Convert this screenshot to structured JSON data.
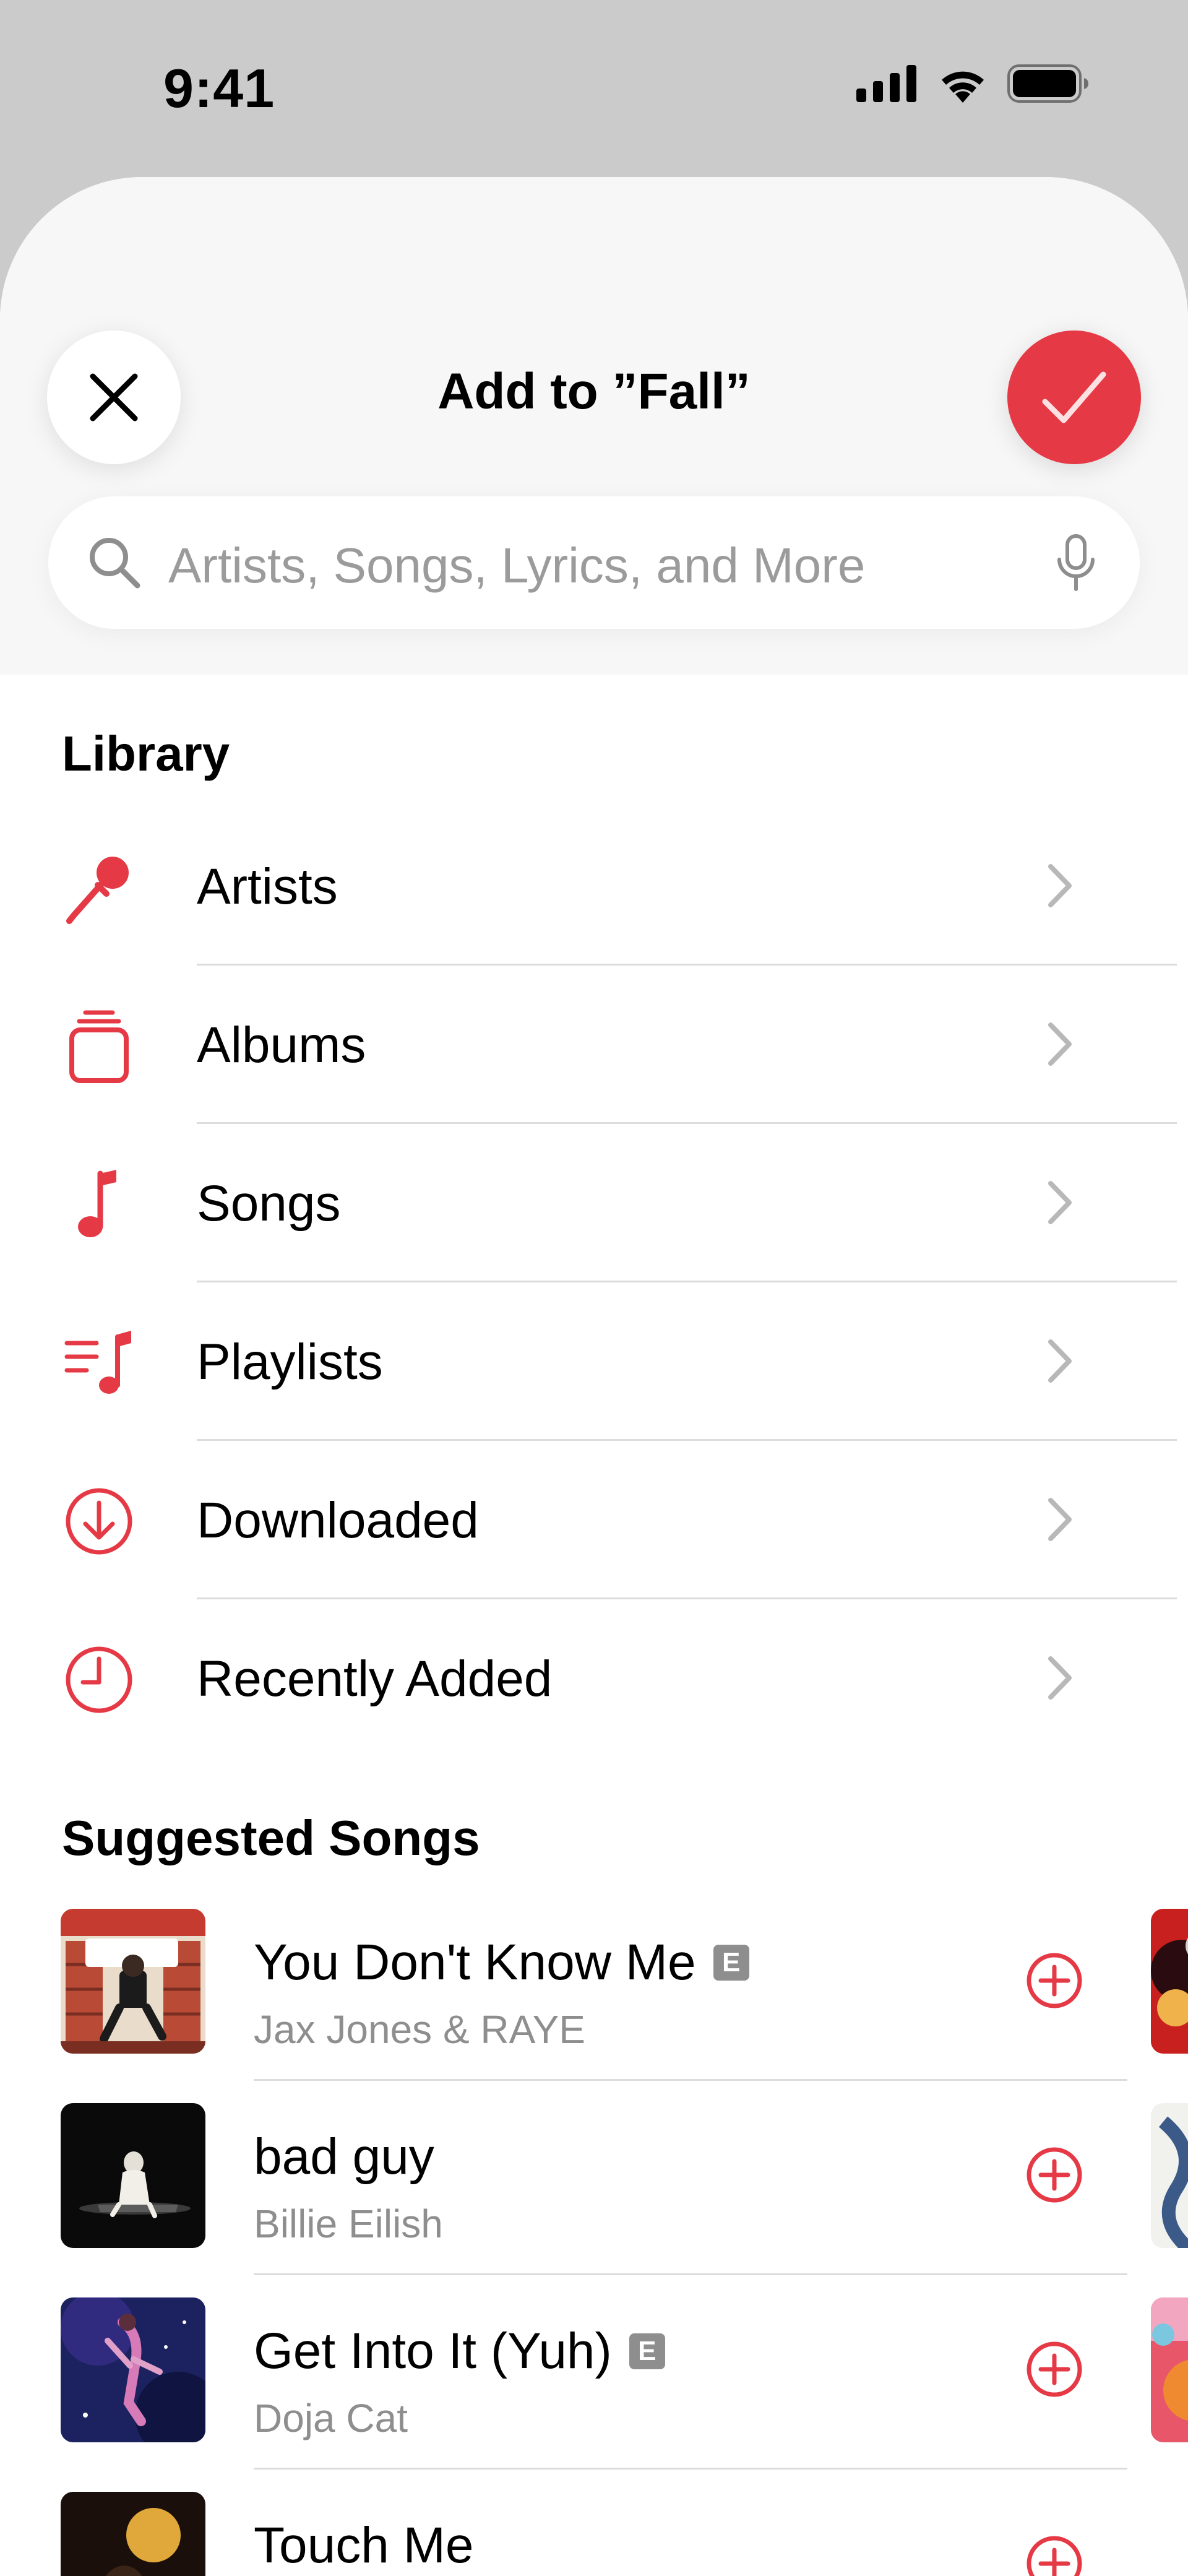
{
  "status_bar": {
    "time": "9:41"
  },
  "header": {
    "title": "Add to ”Fall”",
    "search_placeholder": "Artists, Songs, Lyrics, and More"
  },
  "library": {
    "title": "Library",
    "items": [
      {
        "label": "Artists",
        "icon": "microphone-icon"
      },
      {
        "label": "Albums",
        "icon": "album-stack-icon"
      },
      {
        "label": "Songs",
        "icon": "music-note-icon"
      },
      {
        "label": "Playlists",
        "icon": "playlist-icon"
      },
      {
        "label": "Downloaded",
        "icon": "download-circle-icon"
      },
      {
        "label": "Recently Added",
        "icon": "clock-icon"
      }
    ]
  },
  "suggested": {
    "title": "Suggested Songs",
    "songs": [
      {
        "title": "You Don't Know Me",
        "artist": "Jax Jones & RAYE",
        "explicit": true,
        "explicit_label": "E"
      },
      {
        "title": "bad guy",
        "artist": "Billie Eilish",
        "explicit": false
      },
      {
        "title": "Get Into It (Yuh)",
        "artist": "Doja Cat",
        "explicit": true,
        "explicit_label": "E"
      },
      {
        "title": "Touch Me",
        "artist": "",
        "explicit": false
      }
    ]
  },
  "colors": {
    "accent": "#e63946",
    "secondary_text": "#8e8e8e",
    "sheet_header_bg": "#f7f7f7",
    "backdrop": "#cbcbcb"
  }
}
